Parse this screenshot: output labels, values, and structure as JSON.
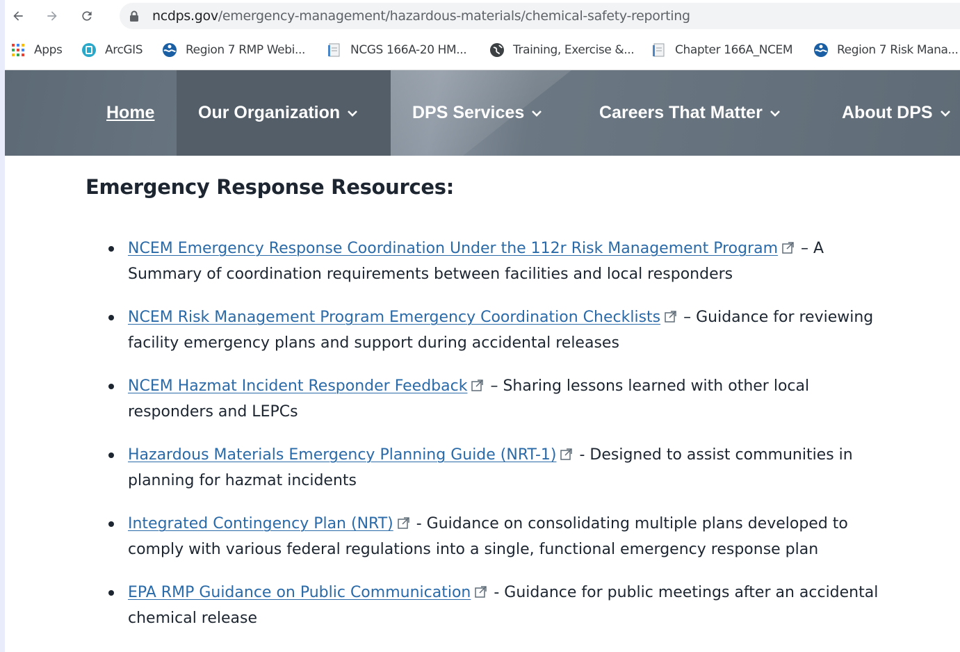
{
  "browser": {
    "url_host": "ncdps.gov",
    "url_path": "/emergency-management/hazardous-materials/chemical-safety-reporting",
    "bookmarks": [
      {
        "label": "Apps",
        "icon": "apps-grid-icon"
      },
      {
        "label": "ArcGIS",
        "icon": "arcgis-icon"
      },
      {
        "label": "Region 7 RMP Webi...",
        "icon": "epa-logo-icon"
      },
      {
        "label": "NCGS 166A-20 HM...",
        "icon": "document-icon"
      },
      {
        "label": "Training, Exercise &...",
        "icon": "globe-icon"
      },
      {
        "label": "Chapter 166A_NCEM",
        "icon": "document-icon"
      },
      {
        "label": "Region 7 Risk Mana...",
        "icon": "epa-logo-icon"
      }
    ]
  },
  "site_nav": {
    "items": [
      {
        "label": "Home",
        "has_dropdown": false
      },
      {
        "label": "Our Organization",
        "has_dropdown": true
      },
      {
        "label": "DPS Services",
        "has_dropdown": true
      },
      {
        "label": "Careers That Matter",
        "has_dropdown": true
      },
      {
        "label": "About DPS",
        "has_dropdown": true
      }
    ]
  },
  "main": {
    "heading": "Emergency Response Resources:",
    "resources": [
      {
        "link": "NCEM Emergency Response Coordination Under the 112r Risk Management Program",
        "description": "– A Summary of coordination requirements between facilities and local responders"
      },
      {
        "link": "NCEM Risk Management Program Emergency Coordination Checklists",
        "description": "– Guidance for reviewing facility emergency plans and support during accidental releases"
      },
      {
        "link": "NCEM Hazmat Incident Responder Feedback",
        "description": "– Sharing lessons learned with other local responders and LEPCs"
      },
      {
        "link": "Hazardous Materials Emergency Planning Guide (NRT-1)",
        "description": "- Designed to assist communities in planning for hazmat incidents"
      },
      {
        "link": "Integrated Contingency Plan (NRT)",
        "description": "- Guidance on consolidating multiple plans developed to comply with various federal regulations into a single, functional emergency response plan"
      },
      {
        "link": "EPA RMP Guidance on Public Communication",
        "description": "- Guidance for public meetings after an accidental chemical release"
      }
    ]
  },
  "colors": {
    "link": "#2a6aa8",
    "nav_bg": "#5f6b76",
    "nav_active_bg": "#535e69",
    "text": "#1c2530"
  }
}
